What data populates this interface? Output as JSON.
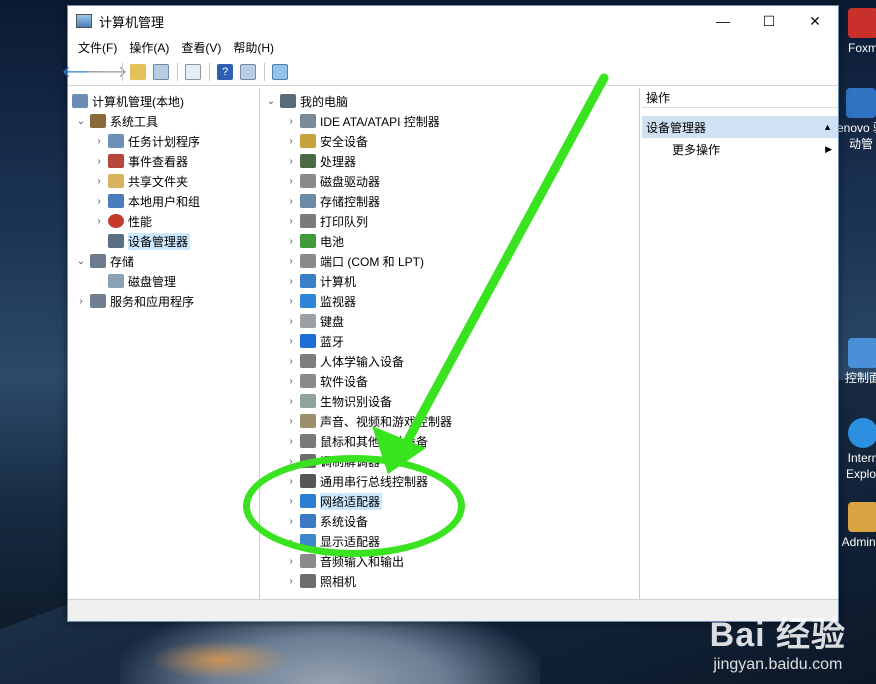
{
  "window": {
    "title": "计算机管理",
    "controls": {
      "minimize": "—",
      "maximize": "☐",
      "close": "✕"
    }
  },
  "menu": [
    "文件(F)",
    "操作(A)",
    "查看(V)",
    "帮助(H)"
  ],
  "left_tree": [
    {
      "label": "计算机管理(本地)",
      "arrow": "",
      "color": "#6b8db5"
    },
    {
      "label": "系统工具",
      "arrow": "⌄",
      "color": "#8b6a3a"
    },
    {
      "label": "任务计划程序",
      "arrow": "›",
      "color": "#6c8fb6"
    },
    {
      "label": "事件查看器",
      "arrow": "›",
      "color": "#b5473a"
    },
    {
      "label": "共享文件夹",
      "arrow": "›",
      "color": "#d7b35b"
    },
    {
      "label": "本地用户和组",
      "arrow": "›",
      "color": "#4c7dba"
    },
    {
      "label": "性能",
      "arrow": "›",
      "color": "#c43a2f"
    },
    {
      "label": "设备管理器",
      "arrow": "",
      "color": "#5b6f84",
      "selected": true
    },
    {
      "label": "存储",
      "arrow": "⌄",
      "color": "#6d7c8c"
    },
    {
      "label": "磁盘管理",
      "arrow": "",
      "color": "#8aa0b4"
    },
    {
      "label": "服务和应用程序",
      "arrow": "›",
      "color": "#6f7f90"
    }
  ],
  "device_tree": {
    "root": "我的电脑",
    "items": [
      {
        "label": "IDE ATA/ATAPI 控制器",
        "color": "#7b8a99"
      },
      {
        "label": "安全设备",
        "color": "#c8a23c"
      },
      {
        "label": "处理器",
        "color": "#4d6a46"
      },
      {
        "label": "磁盘驱动器",
        "color": "#8a8a8a"
      },
      {
        "label": "存储控制器",
        "color": "#6b8aa8"
      },
      {
        "label": "打印队列",
        "color": "#7a7a7a"
      },
      {
        "label": "电池",
        "color": "#3f9b3a"
      },
      {
        "label": "端口 (COM 和 LPT)",
        "color": "#8a8a8a"
      },
      {
        "label": "计算机",
        "color": "#3c7fc9"
      },
      {
        "label": "监视器",
        "color": "#2e86d9"
      },
      {
        "label": "键盘",
        "color": "#9aa0a6"
      },
      {
        "label": "蓝牙",
        "color": "#1d6fd6"
      },
      {
        "label": "人体学输入设备",
        "color": "#7d7d7d"
      },
      {
        "label": "软件设备",
        "color": "#8a8a8a"
      },
      {
        "label": "生物识别设备",
        "color": "#8fa39a"
      },
      {
        "label": "声音、视频和游戏控制器",
        "color": "#9c8d6b"
      },
      {
        "label": "鼠标和其他指针设备",
        "color": "#7a7a7a"
      },
      {
        "label": "调制解调器",
        "color": "#6d6d6d"
      },
      {
        "label": "通用串行总线控制器",
        "color": "#555555"
      },
      {
        "label": "网络适配器",
        "color": "#2b7fd0",
        "selected": true
      },
      {
        "label": "系统设备",
        "color": "#3a7bc4"
      },
      {
        "label": "显示适配器",
        "color": "#3d86c9"
      },
      {
        "label": "音频输入和输出",
        "color": "#8a8a8a"
      },
      {
        "label": "照相机",
        "color": "#6d6d6d"
      }
    ]
  },
  "actions": {
    "header": "操作",
    "group": "设备管理器",
    "item": "更多操作"
  },
  "desktop_icons": [
    {
      "label": "Foxm",
      "color": "#c9302c"
    },
    {
      "label": "enovo 驱动管",
      "color": "#2f74c0"
    },
    {
      "label": "控制面",
      "color": "#4a90d9"
    },
    {
      "label": "Intern Explor",
      "color": "#2c8fe0"
    },
    {
      "label": "Adminis",
      "color": "#d9a441"
    }
  ],
  "watermark": {
    "brand": "Bai 经验",
    "url": "jingyan.baidu.com"
  },
  "annotation_color": "#39e31f"
}
